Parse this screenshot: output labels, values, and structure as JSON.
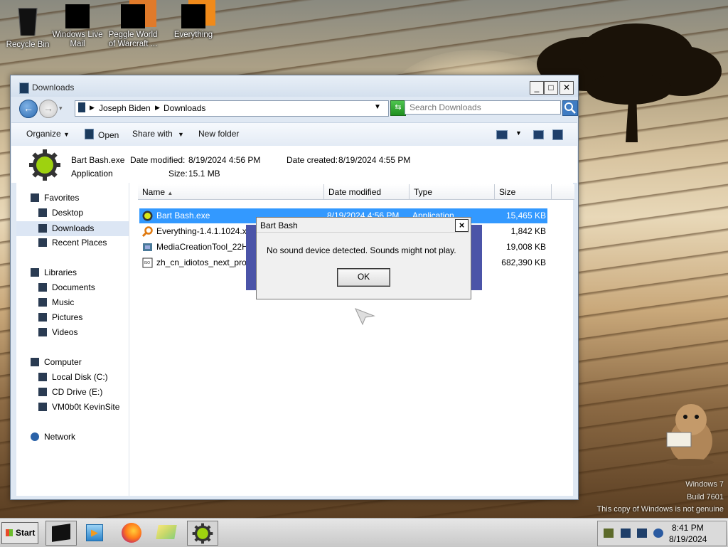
{
  "desktop": {
    "icons": [
      {
        "label": "Recycle Bin",
        "icon": "recycle-bin-icon"
      },
      {
        "label": "Windows Live Mail",
        "icon": "windows-live-mail-icon"
      },
      {
        "label": "Peggle World of Warcraft ...",
        "icon": "peggle-icon"
      },
      {
        "label": "Everything",
        "icon": "everything-icon"
      }
    ],
    "watermark": {
      "line1": "Windows 7",
      "line2": "Build 7601",
      "line3": "This copy of Windows is not genuine"
    }
  },
  "explorer": {
    "title": "Downloads",
    "breadcrumb": [
      "Joseph Biden",
      "Downloads"
    ],
    "search_placeholder": "Search Downloads",
    "toolbar": {
      "organize": "Organize",
      "open": "Open",
      "share_with": "Share with",
      "new_folder": "New folder"
    },
    "details": {
      "name": "Bart Bash.exe",
      "type": "Application",
      "modified_label": "Date modified:",
      "modified": "8/19/2024 4:56 PM",
      "created_label": "Date created:",
      "created": "8/19/2024 4:55 PM",
      "size_label": "Size:",
      "size": "15.1 MB"
    },
    "nav": {
      "favorites": "Favorites",
      "desktop": "Desktop",
      "downloads": "Downloads",
      "recent": "Recent Places",
      "libraries": "Libraries",
      "documents": "Documents",
      "music": "Music",
      "pictures": "Pictures",
      "videos": "Videos",
      "computer": "Computer",
      "local_disk": "Local Disk (C:)",
      "cd_drive": "CD Drive (E:)",
      "share": "VM0b0t KevinSite",
      "network": "Network"
    },
    "columns": {
      "name": "Name",
      "date": "Date modified",
      "type": "Type",
      "size": "Size"
    },
    "files": [
      {
        "name": "Bart Bash.exe",
        "date": "8/19/2024 4:56 PM",
        "type": "Application",
        "size": "15,465 KB",
        "selected": true
      },
      {
        "name": "Everything-1.4.1.1024.x6",
        "date": "",
        "type": "",
        "size": "1,842 KB",
        "selected": false
      },
      {
        "name": "MediaCreationTool_22H",
        "date": "",
        "type": "",
        "size": "19,008 KB",
        "selected": false
      },
      {
        "name": "zh_cn_idiotos_next_prof",
        "date": "",
        "type": "",
        "size": "682,390 KB",
        "selected": false
      }
    ]
  },
  "dialog": {
    "title": "Bart Bash",
    "message": "No sound device detected. Sounds might not play.",
    "ok_label": "OK",
    "close_glyph": "×"
  },
  "taskbar": {
    "start_label": "Start",
    "time": "8:41 PM",
    "date": "8/19/2024"
  },
  "colors": {
    "selection": "#3399ff",
    "dialog_shadow": "#4b54a8"
  }
}
